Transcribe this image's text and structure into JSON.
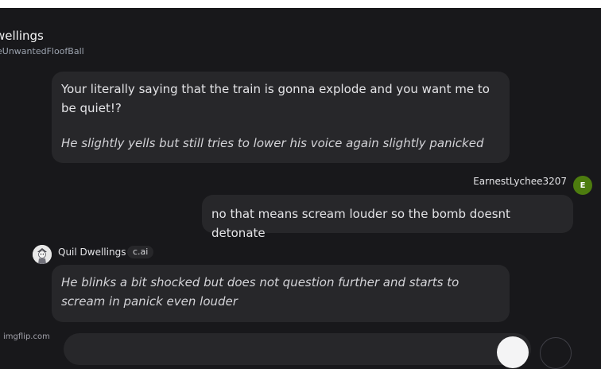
{
  "header": {
    "name": "wellings",
    "handle": "eUnwantedFloofBall"
  },
  "messages": [
    {
      "line1": "Your literally saying that the train is gonna explode and you want me to",
      "line2": "be quiet!?",
      "action": "He slightly yells but still tries to lower his voice again slightly panicked"
    },
    {
      "author": "EarnestLychee3207",
      "avatar_letter": "E",
      "text": "no that means scream louder so the bomb doesnt detonate"
    },
    {
      "author": "Quil Dwellings",
      "badge": "c.ai",
      "line1": "He blinks a bit shocked but does not question further and starts to",
      "line2": "scream in panick even louder"
    }
  ],
  "watermark": "imgflip.com",
  "colors": {
    "background": "#18181b",
    "bubble": "#27272a",
    "user_avatar": "#4d7c0f"
  }
}
